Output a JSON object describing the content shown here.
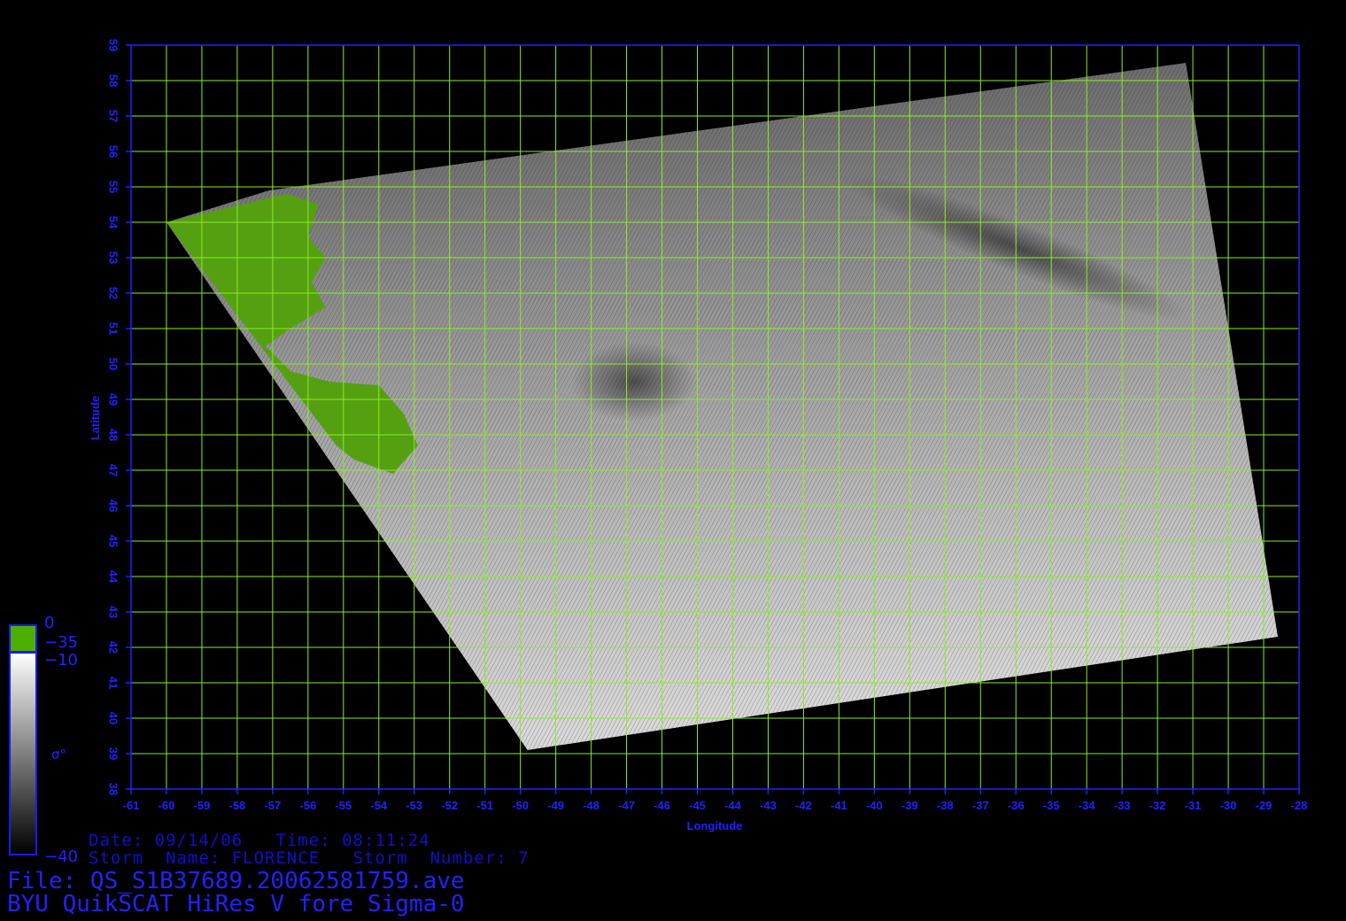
{
  "map": {
    "xlabel": "Longitude",
    "ylabel": "Latitude",
    "lon_range": [
      -61,
      -28
    ],
    "lat_range": [
      38,
      59
    ],
    "lon_ticks": [
      "-61",
      "-60",
      "-59",
      "-58",
      "-57",
      "-56",
      "-55",
      "-54",
      "-53",
      "-52",
      "-51",
      "-50",
      "-49",
      "-48",
      "-47",
      "-46",
      "-45",
      "-44",
      "-43",
      "-42",
      "-41",
      "-40",
      "-39",
      "-38",
      "-37",
      "-36",
      "-35",
      "-34",
      "-33",
      "-32",
      "-31",
      "-30",
      "-29",
      "-28"
    ],
    "lat_ticks": [
      "38",
      "39",
      "40",
      "41",
      "42",
      "43",
      "44",
      "45",
      "46",
      "47",
      "48",
      "49",
      "50",
      "51",
      "52",
      "53",
      "54",
      "55",
      "56",
      "57",
      "58",
      "59"
    ],
    "grid": true,
    "grid_color": "#88ee22",
    "frame_color": "#2222ff",
    "label_color": "#2222ff",
    "land_color": "#55a010",
    "swath_corners_lonlat": [
      [
        -57.1,
        54.9
      ],
      [
        -31.2,
        58.5
      ],
      [
        -28.6,
        42.3
      ],
      [
        -49.8,
        39.1
      ],
      [
        -60.0,
        54.0
      ]
    ]
  },
  "colorbar": {
    "land_label": "0",
    "label_minus35": "−35",
    "label_top": "−10",
    "label_bottom": "−40",
    "symbol": "σ°",
    "land_color": "#4caf00"
  },
  "info": {
    "date_line": "Date: 09/14/06   Time: 08:11:24",
    "storm_line": "Storm  Name: FLORENCE   Storm  Number: 7",
    "file_line": "File: QS_S1B37689.20062581759.ave",
    "product_line": "BYU QuikSCAT HiRes V fore Sigma-0"
  }
}
